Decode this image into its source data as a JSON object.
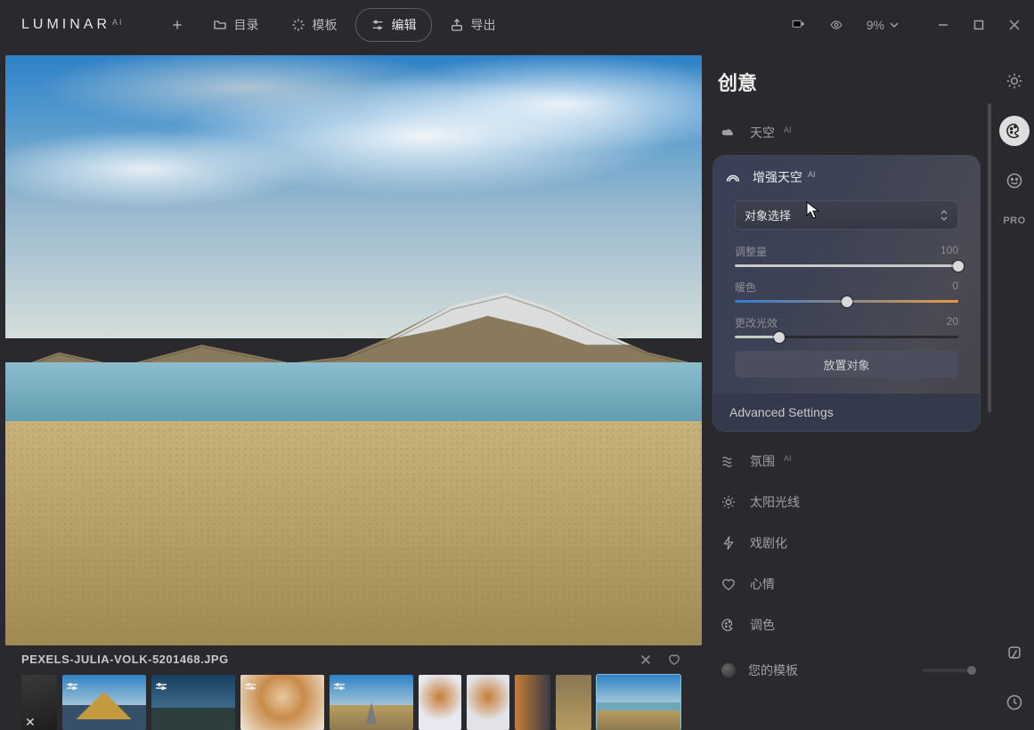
{
  "app": {
    "name": "LUMINAR",
    "badge": "AI"
  },
  "nav": {
    "catalog": "目录",
    "templates": "模板",
    "edit": "编辑",
    "export": "导出"
  },
  "zoom": "9%",
  "file": {
    "name": "PEXELS-JULIA-VOLK-5201468.JPG"
  },
  "panel": {
    "title": "创意",
    "tools": {
      "sky": {
        "label": "天空",
        "badge": "AI"
      },
      "skyEnh": {
        "label": "增强天空",
        "badge": "AI"
      },
      "atmos": {
        "label": "氛围",
        "badge": "AI"
      },
      "sunrays": {
        "label": "太阳光线"
      },
      "dramatic": {
        "label": "戏剧化"
      },
      "mood": {
        "label": "心情"
      },
      "tone": {
        "label": "调色"
      }
    },
    "select": {
      "label": "对象选择"
    },
    "sliders": {
      "amount": {
        "label": "调整量",
        "value": 100,
        "pct": 100
      },
      "warm": {
        "label": "暖色",
        "value": 0,
        "pct": 50
      },
      "relight": {
        "label": "更改光效",
        "value": 20,
        "pct": 20
      }
    },
    "placeBtn": "放置对象",
    "advanced": "Advanced Settings",
    "templates": "您的模板"
  },
  "rail": {
    "pro": "PRO"
  }
}
